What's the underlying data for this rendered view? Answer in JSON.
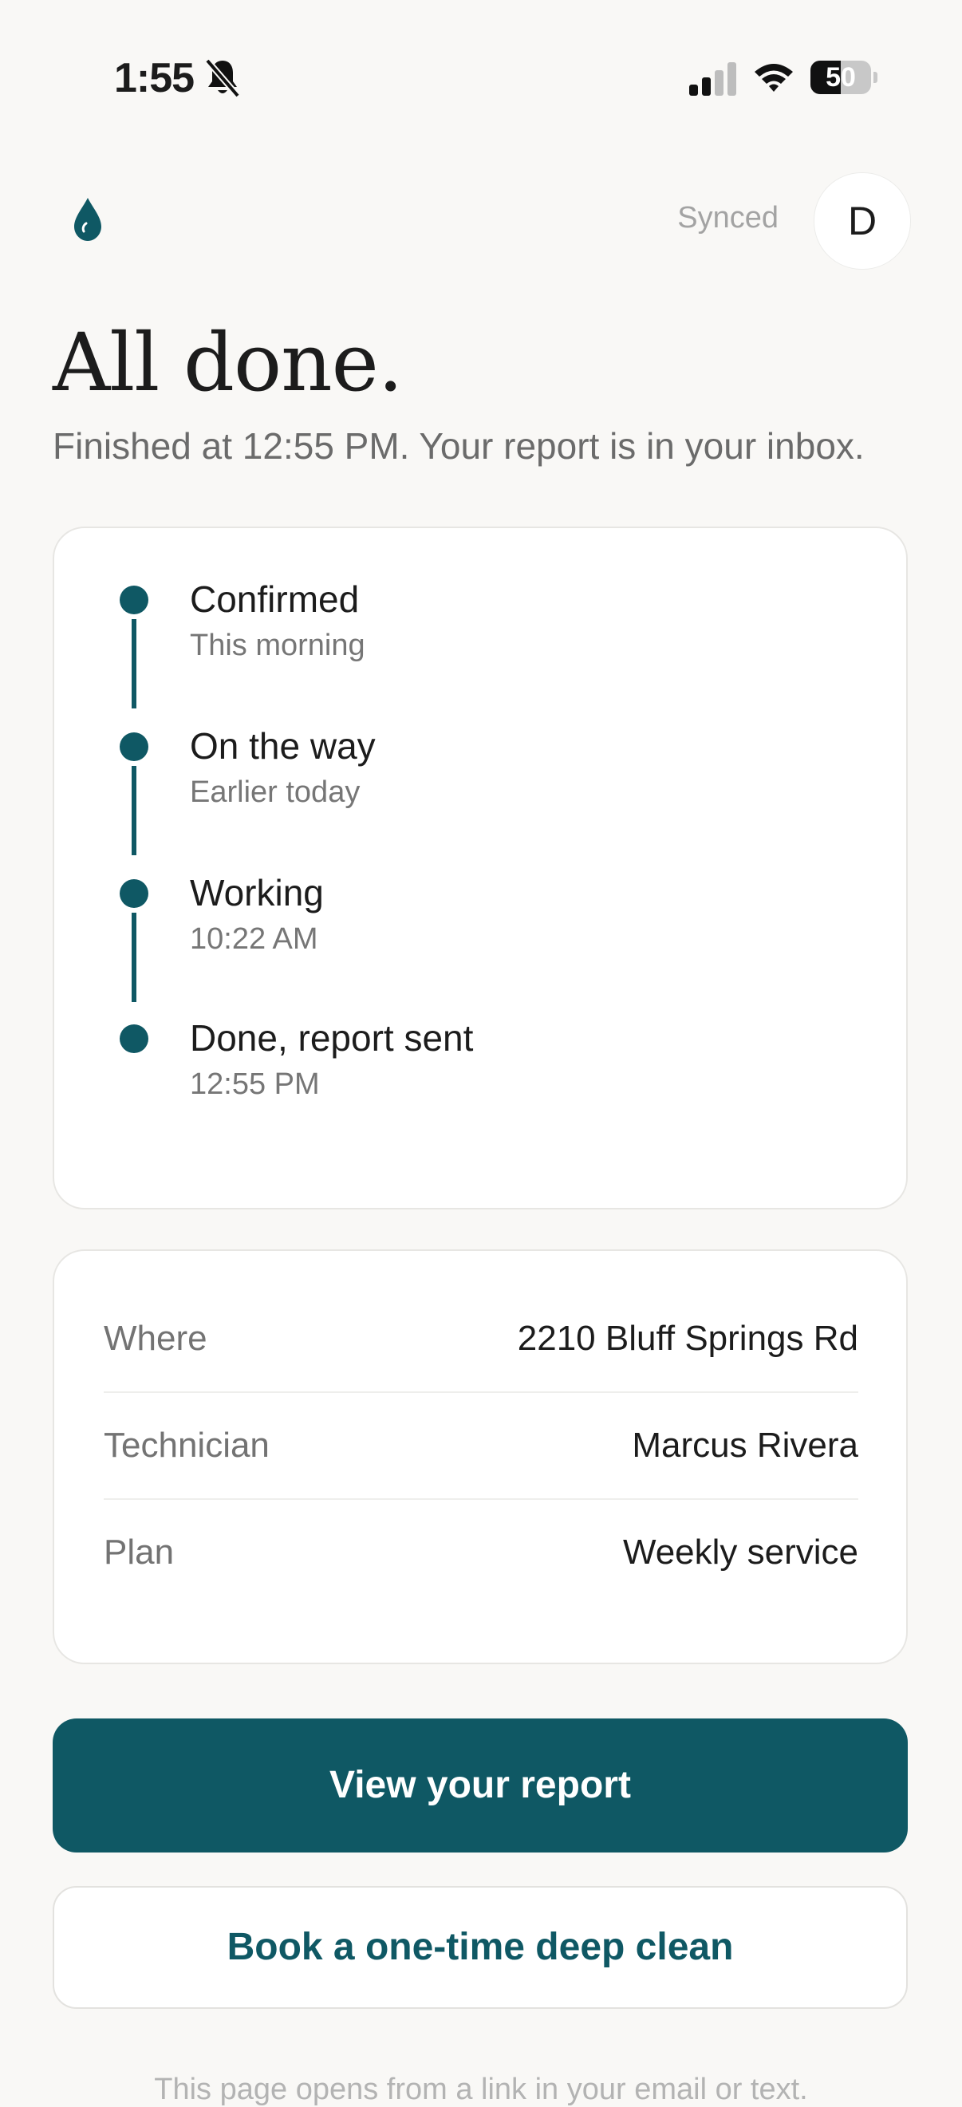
{
  "status_bar": {
    "time": "1:55",
    "battery": "50",
    "battery_level": 0.5
  },
  "header": {
    "sync_status": "Synced",
    "avatar_initial": "D",
    "accent_color": "#0f5864"
  },
  "page": {
    "title": "All done.",
    "subtitle": "Finished at 12:55 PM. Your report is in your inbox."
  },
  "timeline": {
    "steps": [
      {
        "label": "Confirmed",
        "sub": "This morning"
      },
      {
        "label": "On the way",
        "sub": "Earlier today"
      },
      {
        "label": "Working",
        "sub": "10:22 AM"
      },
      {
        "label": "Done, report sent",
        "sub": "12:55 PM"
      }
    ]
  },
  "details": {
    "rows": [
      {
        "label": "Where",
        "value": "2210 Bluff Springs Rd"
      },
      {
        "label": "Technician",
        "value": "Marcus Rivera"
      },
      {
        "label": "Plan",
        "value": "Weekly service"
      }
    ]
  },
  "actions": {
    "primary_label": "View your report",
    "secondary_label": "Book a one-time deep clean"
  },
  "footer": {
    "note": "This page opens from a link in your email or text."
  }
}
